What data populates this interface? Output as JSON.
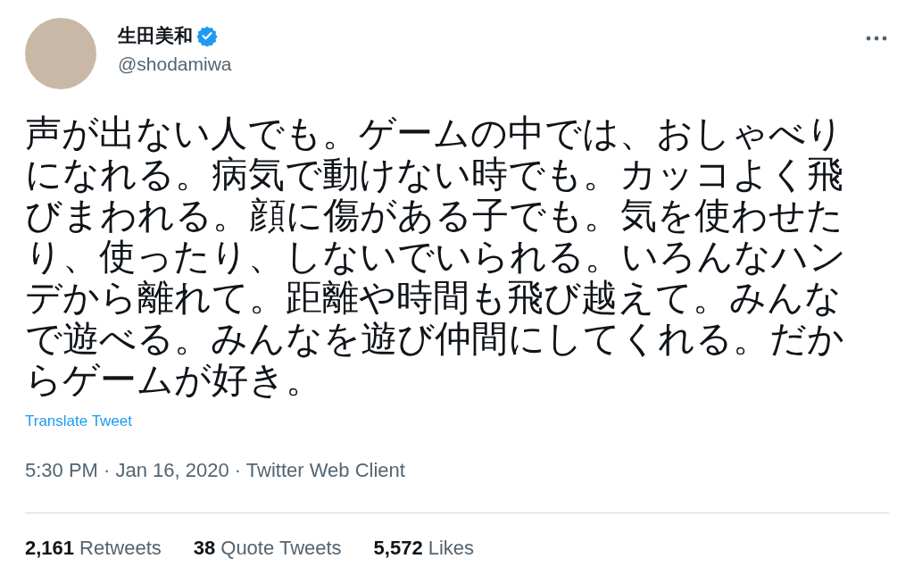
{
  "author": {
    "name": "生田美和",
    "handle": "@shodamiwa",
    "verified": true
  },
  "tweet": {
    "text": "声が出ない人でも。ゲームの中では、おしゃべりになれる。病気で動けない時でも。カッコよく飛びまわれる。顔に傷がある子でも。気を使わせたり、使ったり、しないでいられる。いろんなハンデから離れて。距離や時間も飛び越えて。みんなで遊べる。みんなを遊び仲間にしてくれる。だからゲームが好き。",
    "translate_link": "Translate Tweet",
    "timestamp": "5:30 PM · Jan 16, 2020 · Twitter Web Client"
  },
  "stats": [
    {
      "count": "2,161",
      "label": "Retweets"
    },
    {
      "count": "38",
      "label": "Quote Tweets"
    },
    {
      "count": "5,572",
      "label": "Likes"
    }
  ]
}
